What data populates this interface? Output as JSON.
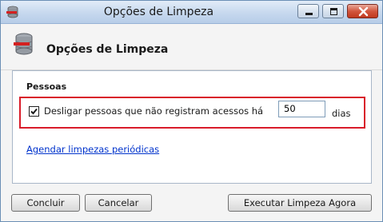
{
  "window": {
    "title": "Opções de Limpeza",
    "controls": {
      "minimize_icon": "minimize-icon",
      "maximize_icon": "maximize-icon",
      "close_icon": "close-icon"
    }
  },
  "header": {
    "title": "Opções de Limpeza",
    "icon": "database-delete-icon"
  },
  "group": {
    "label": "Pessoas",
    "option": {
      "checked": true,
      "label": "Desligar pessoas que não registram acessos há",
      "days_value": "50",
      "days_unit": "dias"
    },
    "link_label": "Agendar limpezas periódicas"
  },
  "footer": {
    "concluir_label": "Concluir",
    "cancelar_label": "Cancelar",
    "executar_label": "Executar Limpeza Agora"
  },
  "colors": {
    "highlight_border": "#d91c2a",
    "link": "#0033cc",
    "close_button": "#c0391f"
  }
}
